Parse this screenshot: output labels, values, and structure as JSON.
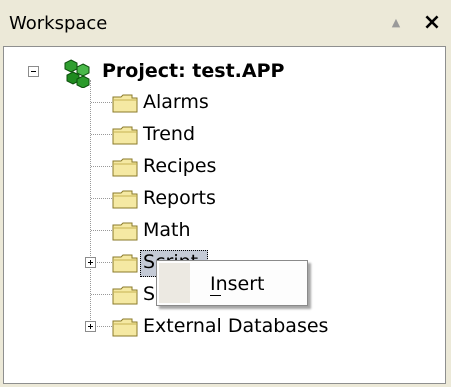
{
  "workspace": {
    "title": "Workspace",
    "pin_icon": "triangle-up-icon",
    "close_icon": "close-icon"
  },
  "tree": {
    "project": {
      "label": "Project: test.APP",
      "icon": "project-cubes-icon",
      "expanded": true
    },
    "items": [
      {
        "label": "Alarms",
        "icon": "folder-icon",
        "expandable": false
      },
      {
        "label": "Trend",
        "icon": "folder-icon",
        "expandable": false
      },
      {
        "label": "Recipes",
        "icon": "folder-icon",
        "expandable": false
      },
      {
        "label": "Reports",
        "icon": "folder-icon",
        "expandable": false
      },
      {
        "label": "Math",
        "icon": "folder-icon",
        "expandable": false
      },
      {
        "label": "Script",
        "icon": "folder-icon",
        "expandable": true,
        "selected": true
      },
      {
        "label": "S",
        "icon": "folder-icon",
        "expandable": false
      },
      {
        "label": "External Databases",
        "icon": "folder-icon",
        "expandable": true
      }
    ]
  },
  "context_menu": {
    "items": [
      {
        "label": "Insert",
        "mnemonic": "I"
      }
    ]
  },
  "colors": {
    "panel_bg": "#ece9d8",
    "folder_fill": "#f5e9a3",
    "folder_stroke": "#8a7a2a",
    "selection_bg": "#c4cad6"
  }
}
